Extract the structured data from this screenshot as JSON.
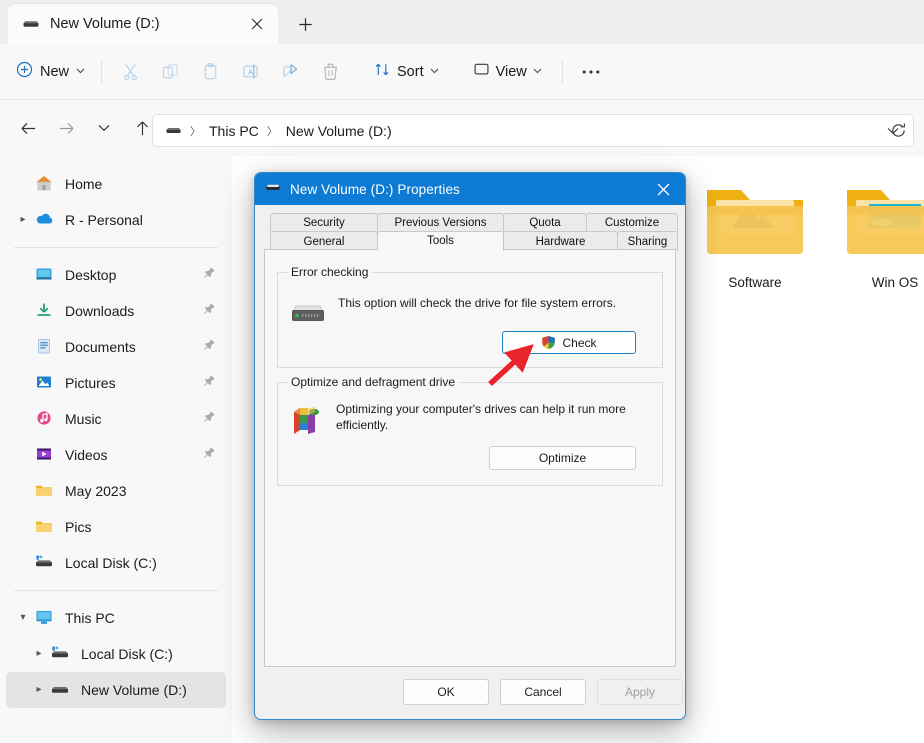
{
  "window": {
    "tab": {
      "title": "New Volume (D:)",
      "icon": "drive-icon",
      "close_icon": "close-icon"
    },
    "new_tab_icon": "plus-icon"
  },
  "toolbar": {
    "new_label": "New",
    "new_icon": "plus-circle-icon",
    "icons": [
      "cut-icon",
      "copy-icon",
      "paste-icon",
      "rename-icon",
      "share-icon",
      "delete-icon"
    ],
    "sort_label": "Sort",
    "sort_icon": "sort-icon",
    "view_label": "View",
    "view_icon": "view-icon",
    "more_label": "•••"
  },
  "navigation": {
    "back_icon": "arrow-left-icon",
    "forward_icon": "arrow-right-icon",
    "recent_icon": "chevron-down-icon",
    "up_icon": "arrow-up-icon",
    "refresh_icon": "refresh-icon",
    "address_dropdown_icon": "chevron-down-icon",
    "breadcrumb_icon": "drive-icon",
    "breadcrumbs": [
      "This PC",
      "New Volume (D:)"
    ]
  },
  "sidebar": {
    "groups": [
      {
        "items": [
          {
            "label": "Home",
            "icon": "home-icon",
            "expandable": false,
            "pinned": false,
            "selected": false,
            "indent": 1
          },
          {
            "label": "R - Personal",
            "icon": "onedrive-icon",
            "expandable": true,
            "pinned": false,
            "selected": false,
            "indent": 1
          }
        ]
      },
      {
        "items": [
          {
            "label": "Desktop",
            "icon": "desktop-icon",
            "expandable": false,
            "pinned": true,
            "selected": false,
            "indent": 1
          },
          {
            "label": "Downloads",
            "icon": "downloads-icon",
            "expandable": false,
            "pinned": true,
            "selected": false,
            "indent": 1
          },
          {
            "label": "Documents",
            "icon": "documents-icon",
            "expandable": false,
            "pinned": true,
            "selected": false,
            "indent": 1
          },
          {
            "label": "Pictures",
            "icon": "pictures-icon",
            "expandable": false,
            "pinned": true,
            "selected": false,
            "indent": 1
          },
          {
            "label": "Music",
            "icon": "music-icon",
            "expandable": false,
            "pinned": true,
            "selected": false,
            "indent": 1
          },
          {
            "label": "Videos",
            "icon": "videos-icon",
            "expandable": false,
            "pinned": true,
            "selected": false,
            "indent": 1
          },
          {
            "label": "May 2023",
            "icon": "folder-icon",
            "expandable": false,
            "pinned": false,
            "selected": false,
            "indent": 1
          },
          {
            "label": "Pics",
            "icon": "folder-icon",
            "expandable": false,
            "pinned": false,
            "selected": false,
            "indent": 1
          },
          {
            "label": "Local Disk (C:)",
            "icon": "local-disk-icon",
            "expandable": false,
            "pinned": false,
            "selected": false,
            "indent": 1
          }
        ]
      },
      {
        "items": [
          {
            "label": "This PC",
            "icon": "this-pc-icon",
            "expandable": true,
            "expanded": true,
            "pinned": false,
            "selected": false,
            "indent": 1
          },
          {
            "label": "Local Disk (C:)",
            "icon": "local-disk-icon",
            "expandable": true,
            "pinned": false,
            "selected": false,
            "indent": 2
          },
          {
            "label": "New Volume (D:)",
            "icon": "drive-icon",
            "expandable": true,
            "pinned": false,
            "selected": true,
            "indent": 2
          }
        ]
      }
    ]
  },
  "content": {
    "folders": [
      {
        "name": "Software",
        "icon": "folder-icon"
      },
      {
        "name": "Win OS",
        "icon": "folder-icon"
      }
    ]
  },
  "dialog": {
    "title": "New Volume (D:) Properties",
    "title_icon": "drive-icon",
    "close_icon": "close-icon",
    "tabs_top": [
      "Security",
      "Previous Versions",
      "Quota",
      "Customize"
    ],
    "tabs_bottom": [
      "General",
      "Tools",
      "Hardware",
      "Sharing"
    ],
    "active_tab": "Tools",
    "error_checking": {
      "group_title": "Error checking",
      "icon": "drive-icon",
      "description": "This option will check the drive for file system errors.",
      "button_label": "Check",
      "button_icon": "shield-icon"
    },
    "optimize": {
      "group_title": "Optimize and defragment drive",
      "icon": "defrag-icon",
      "description": "Optimizing your computer's drives can help it run more efficiently.",
      "button_label": "Optimize"
    },
    "footer": {
      "ok_label": "OK",
      "cancel_label": "Cancel",
      "apply_label": "Apply",
      "apply_disabled": true
    }
  },
  "annotation": {
    "arrow_color": "#e8232a",
    "arrow_points_to": "Check"
  },
  "colors": {
    "dialog_titlebar": "#0d7bd4",
    "dialog_border": "#2f8ad0",
    "accent": "#0067c0",
    "sidebar_selected": "#e4e4e4"
  }
}
